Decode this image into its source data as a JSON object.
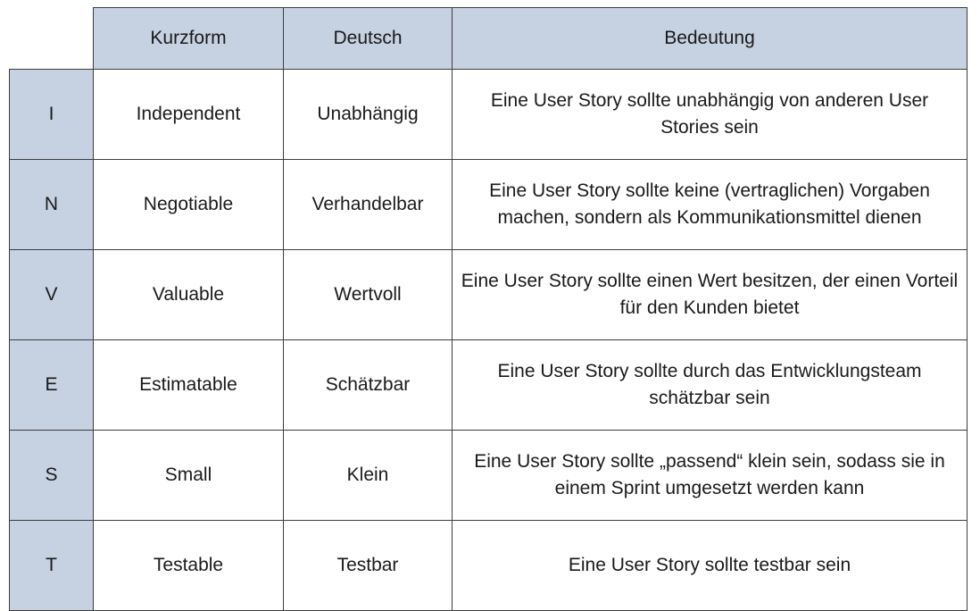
{
  "table": {
    "headers": {
      "short": "Kurzform",
      "german": "Deutsch",
      "meaning": "Bedeutung"
    },
    "rows": [
      {
        "letter": "I",
        "short": "Independent",
        "german": "Unabhängig",
        "meaning": "Eine User Story sollte unabhängig von anderen User Stories sein"
      },
      {
        "letter": "N",
        "short": "Negotiable",
        "german": "Verhandelbar",
        "meaning": "Eine User Story sollte keine (vertraglichen) Vorgaben machen, sondern als Kommunikationsmittel dienen"
      },
      {
        "letter": "V",
        "short": "Valuable",
        "german": "Wertvoll",
        "meaning": "Eine User Story sollte einen Wert besitzen, der einen Vorteil für den Kunden bietet"
      },
      {
        "letter": "E",
        "short": "Estimatable",
        "german": "Schätzbar",
        "meaning": "Eine User Story sollte durch das Entwicklungsteam schätzbar sein"
      },
      {
        "letter": "S",
        "short": "Small",
        "german": "Klein",
        "meaning": "Eine User Story sollte „passend“ klein sein, sodass sie in einem Sprint umgesetzt werden kann"
      },
      {
        "letter": "T",
        "short": "Testable",
        "german": "Testbar",
        "meaning": "Eine User Story sollte testbar sein"
      }
    ]
  },
  "colors": {
    "header_fill": "#c6d1e2",
    "border": "#3d3d3d"
  }
}
